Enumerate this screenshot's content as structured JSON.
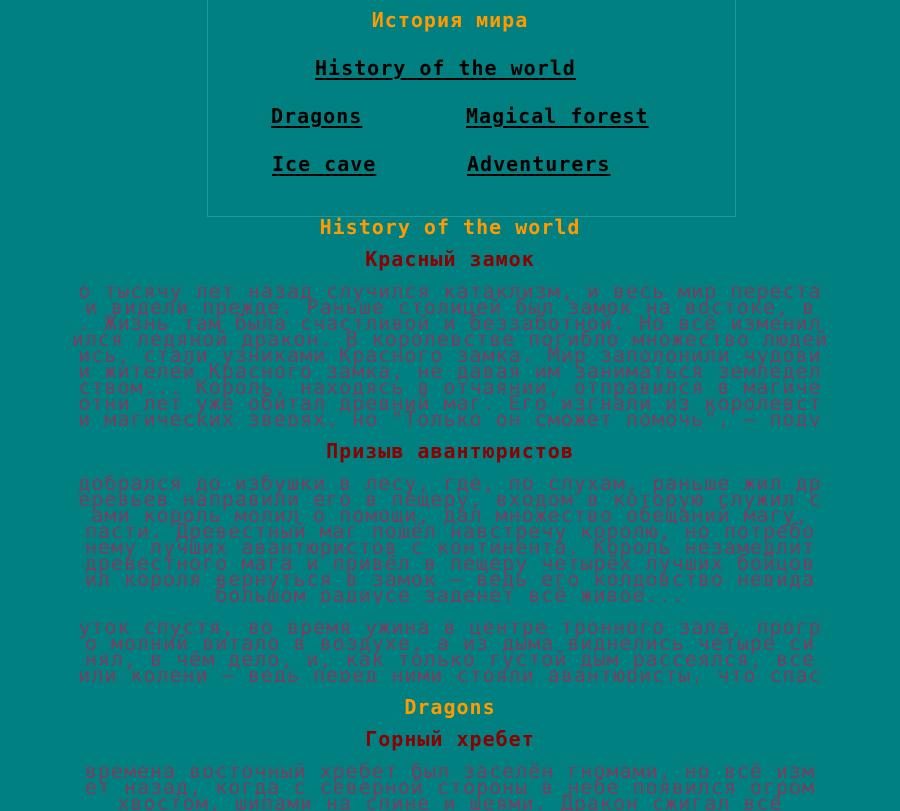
{
  "site_title": "История мира",
  "nav": {
    "history": "History of the world",
    "dragons": "Dragons",
    "forest": "Magical forest",
    "ice": "Ice cave",
    "adventurers": "Adventurers"
  },
  "section1": {
    "title": "History of the world",
    "sub1": "Красный замок",
    "para1": [
      "о тысячу лет назад случился катаклизм, и весь мир переста",
      "и видели прежде. Раньше столицей был замок на востоке, в",
      ". Жизнь там была счастливой и беззаботной. Но всё изменил",
      "ился ледяной дракон. В королевстве погибло множество людей",
      "ись, стали узниками Красного замка. Мир заполонили чудови",
      "и жителей Красного замка, не давая им заниматься земледел",
      "ством... Король, находясь в отчаянии, отправился в магиче",
      "отни лет уже обитал древний маг. Его изгнали из королевст",
      "и магических зверях, но \"Только он сможет помочь\", — поду"
    ],
    "sub2": "Призыв авантюристов",
    "para2": [
      "добрался до избушки в лесу, где, по слухам, раньше жил др",
      "еревьев направили его в пещеру, входом в которую служил с",
      "ами король молил о помощи, дал множество обещаний магу,",
      "пасти. Древестный маг пошёл навстречу королю, но потребо",
      "нему лучших авантюристов с континента. Король незамедлит",
      "древестного мага и привёл в пещеру четырёх лучших бойцов",
      "ил короля вернуться в замок — ведь его колдовство невида",
      "большом радиусе заденет всё живое..."
    ],
    "para3": [
      "уток спустя, во время ужина в центре тронного зала, прогр",
      "о молний витало в воздухе, а из дыма виднелись четыре си",
      "нял, в чём дело, и, как только густой дым рассеялся, все",
      "или колени — ведь перед ними стояли авантюристы, что спас"
    ]
  },
  "section2": {
    "title": "Dragons",
    "sub1": "Горный хребет",
    "para1": [
      "времена восточный хребет был заселён гномами, но всё изм",
      "ет назад, когда с северной стороны в небе появился огром",
      "хвостом, шипами на спине и шеями. Дракон сжигал всё"
    ]
  }
}
